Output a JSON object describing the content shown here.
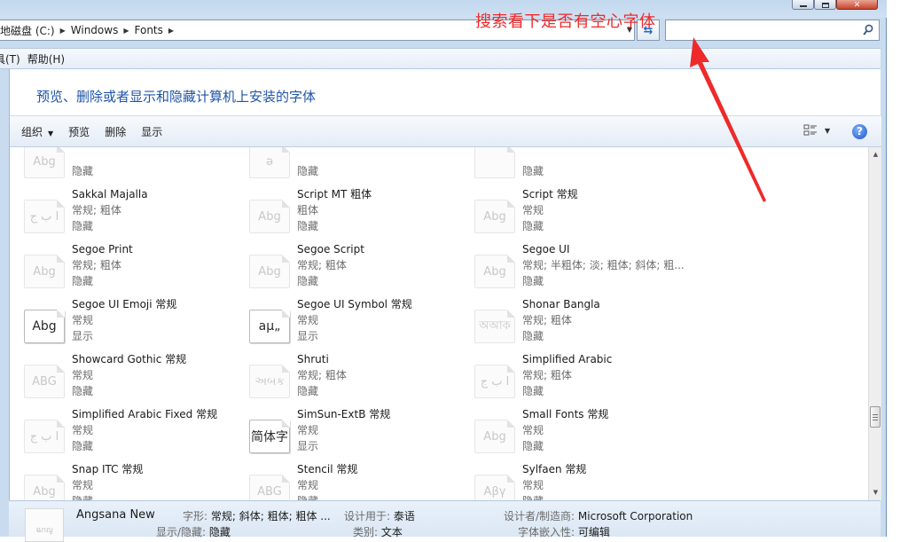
{
  "address": {
    "crumbs": [
      "地磁盘 (C:)",
      "Windows",
      "Fonts"
    ]
  },
  "search": {
    "value": "",
    "placeholder": ""
  },
  "annotation": {
    "text": "搜索看下是否有空心字体",
    "color": "#ee2a2a"
  },
  "menu": {
    "items": [
      "具(T)",
      "帮助(H)"
    ]
  },
  "header": {
    "title": "预览、删除或者显示和隐藏计算机上安装的字体"
  },
  "toolbar": {
    "organize": "组织",
    "preview": "预览",
    "delete": "删除",
    "show": "显示"
  },
  "fonts": [
    {
      "name": "",
      "styles": "",
      "status": "隐藏",
      "thumb": "Abg",
      "shown": false
    },
    {
      "name": "",
      "styles": "",
      "status": "隐藏",
      "thumb": "ǝ",
      "shown": false
    },
    {
      "name": "",
      "styles": "",
      "status": "隐藏",
      "thumb": "",
      "shown": false
    },
    {
      "name": "Sakkal Majalla",
      "styles": "常规; 粗体",
      "status": "隐藏",
      "thumb": "ا ب ج",
      "shown": false
    },
    {
      "name": "Script MT 粗体",
      "styles": "粗体",
      "status": "隐藏",
      "thumb": "Abg",
      "shown": false
    },
    {
      "name": "Script 常规",
      "styles": "常规",
      "status": "隐藏",
      "thumb": "Abg",
      "shown": false
    },
    {
      "name": "Segoe Print",
      "styles": "常规; 粗体",
      "status": "隐藏",
      "thumb": "Abg",
      "shown": false
    },
    {
      "name": "Segoe Script",
      "styles": "常规; 粗体",
      "status": "隐藏",
      "thumb": "Abg",
      "shown": false
    },
    {
      "name": "Segoe UI",
      "styles": "常规; 半粗体; 淡; 粗体; 斜体; 粗...",
      "status": "隐藏",
      "thumb": "Abg",
      "shown": false
    },
    {
      "name": "Segoe UI Emoji 常规",
      "styles": "常规",
      "status": "显示",
      "thumb": "Abg",
      "shown": true
    },
    {
      "name": "Segoe UI Symbol 常规",
      "styles": "常规",
      "status": "显示",
      "thumb": "aµ„",
      "shown": true
    },
    {
      "name": "Shonar Bangla",
      "styles": "常规; 粗体",
      "status": "隐藏",
      "thumb": "অআক",
      "shown": false
    },
    {
      "name": "Showcard Gothic 常规",
      "styles": "常规",
      "status": "隐藏",
      "thumb": "ABG",
      "shown": false
    },
    {
      "name": "Shruti",
      "styles": "常规; 粗体",
      "status": "隐藏",
      "thumb": "અબક",
      "shown": false
    },
    {
      "name": "Simplified Arabic",
      "styles": "常规; 粗体",
      "status": "隐藏",
      "thumb": "ا ب ج",
      "shown": false
    },
    {
      "name": "Simplified Arabic Fixed 常规",
      "styles": "常规",
      "status": "隐藏",
      "thumb": "ا ب ج",
      "shown": false
    },
    {
      "name": "SimSun-ExtB 常规",
      "styles": "常规",
      "status": "显示",
      "thumb": "简体字",
      "shown": true
    },
    {
      "name": "Small Fonts 常规",
      "styles": "常规",
      "status": "隐藏",
      "thumb": "Abg",
      "shown": false
    },
    {
      "name": "Snap ITC 常规",
      "styles": "常规",
      "status": "隐藏",
      "thumb": "Abg",
      "shown": false
    },
    {
      "name": "Stencil 常规",
      "styles": "常规",
      "status": "隐藏",
      "thumb": "ABG",
      "shown": false
    },
    {
      "name": "Sylfaen 常规",
      "styles": "常规",
      "status": "隐藏",
      "thumb": "Aβγ",
      "shown": false
    }
  ],
  "details": {
    "name": "Angsana New",
    "thumb": "ฉกญ",
    "style_label": "字形:",
    "style_value": "常规; 斜体; 粗体; 粗体 ...",
    "designed_label": "设计用于:",
    "designed_value": "泰语",
    "maker_label": "设计者/制造商:",
    "maker_value": "Microsoft Corporation",
    "showhide_label": "显示/隐藏:",
    "showhide_value": "隐藏",
    "category_label": "类别:",
    "category_value": "文本",
    "embed_label": "字体嵌入性:",
    "embed_value": "可编辑"
  }
}
